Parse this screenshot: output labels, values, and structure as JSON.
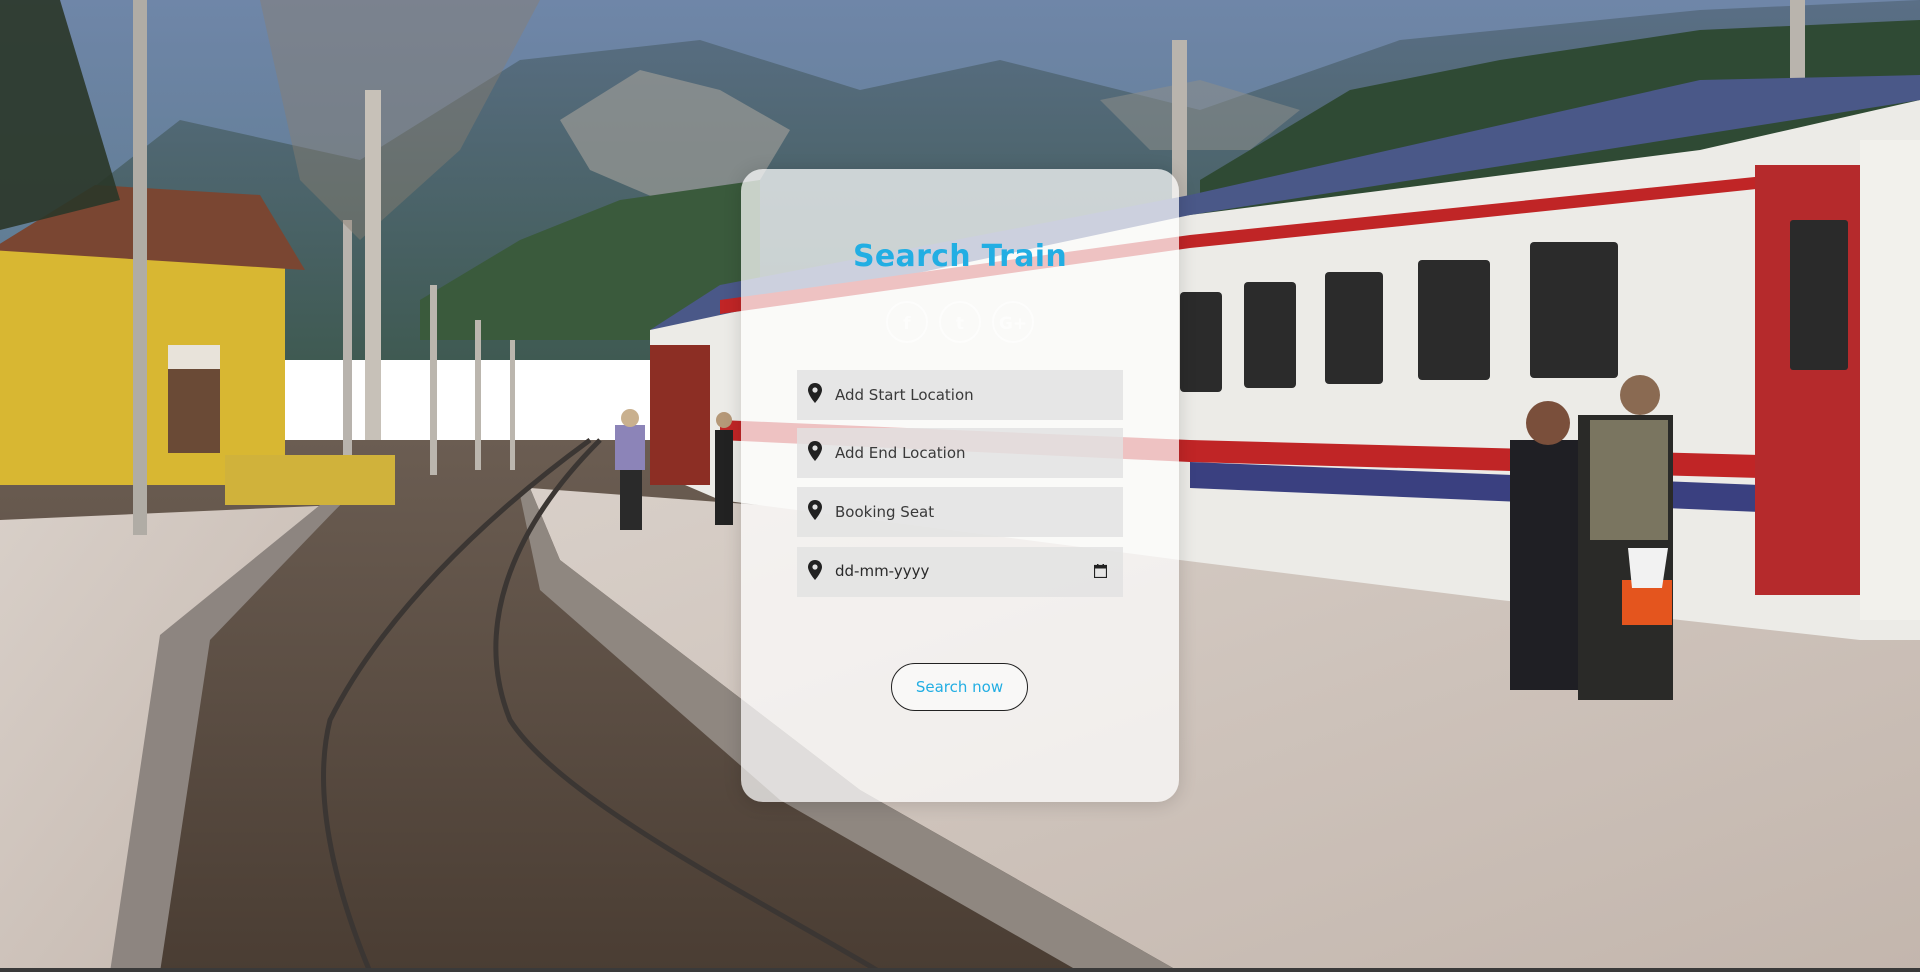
{
  "background": {
    "description_icon": "train-station-photo"
  },
  "card": {
    "title": "Search Train",
    "social_icons": [
      {
        "icon": "facebook-icon",
        "glyph": "f"
      },
      {
        "icon": "twitter-icon",
        "glyph": "t"
      },
      {
        "icon": "google-icon",
        "glyph": "G+"
      }
    ],
    "fields": {
      "start": {
        "placeholder": "Add Start Location",
        "icon": "location-pin-icon"
      },
      "end": {
        "placeholder": "Add End Location",
        "icon": "location-pin-icon"
      },
      "seat": {
        "placeholder": "Booking Seat",
        "icon": "location-pin-icon"
      },
      "date": {
        "placeholder": "dd-mm-yyyy",
        "icon": "location-pin-icon",
        "picker_icon": "calendar-icon"
      }
    },
    "search_label": "Search now"
  },
  "colors": {
    "accent": "#22aee3",
    "card_bg": "rgba(255,255,255,0.72)",
    "field_bg": "#e2e2e2"
  }
}
